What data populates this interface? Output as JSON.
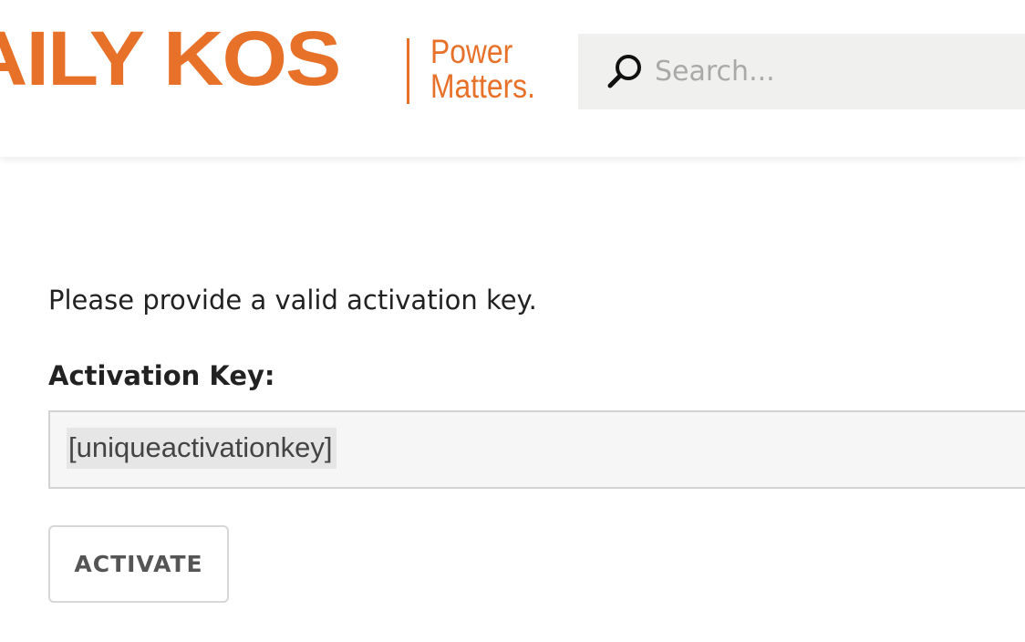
{
  "header": {
    "logo_text": "AILY KOS",
    "tagline_line1": "Power",
    "tagline_line2": "Matters.",
    "brand_color": "#e8712a"
  },
  "search": {
    "placeholder": "Search...",
    "icon": "search-icon"
  },
  "activation": {
    "message": "Please provide a valid activation key.",
    "label": "Activation Key:",
    "key_value": "[uniqueactivationkey]",
    "button_label": "ACTIVATE"
  }
}
